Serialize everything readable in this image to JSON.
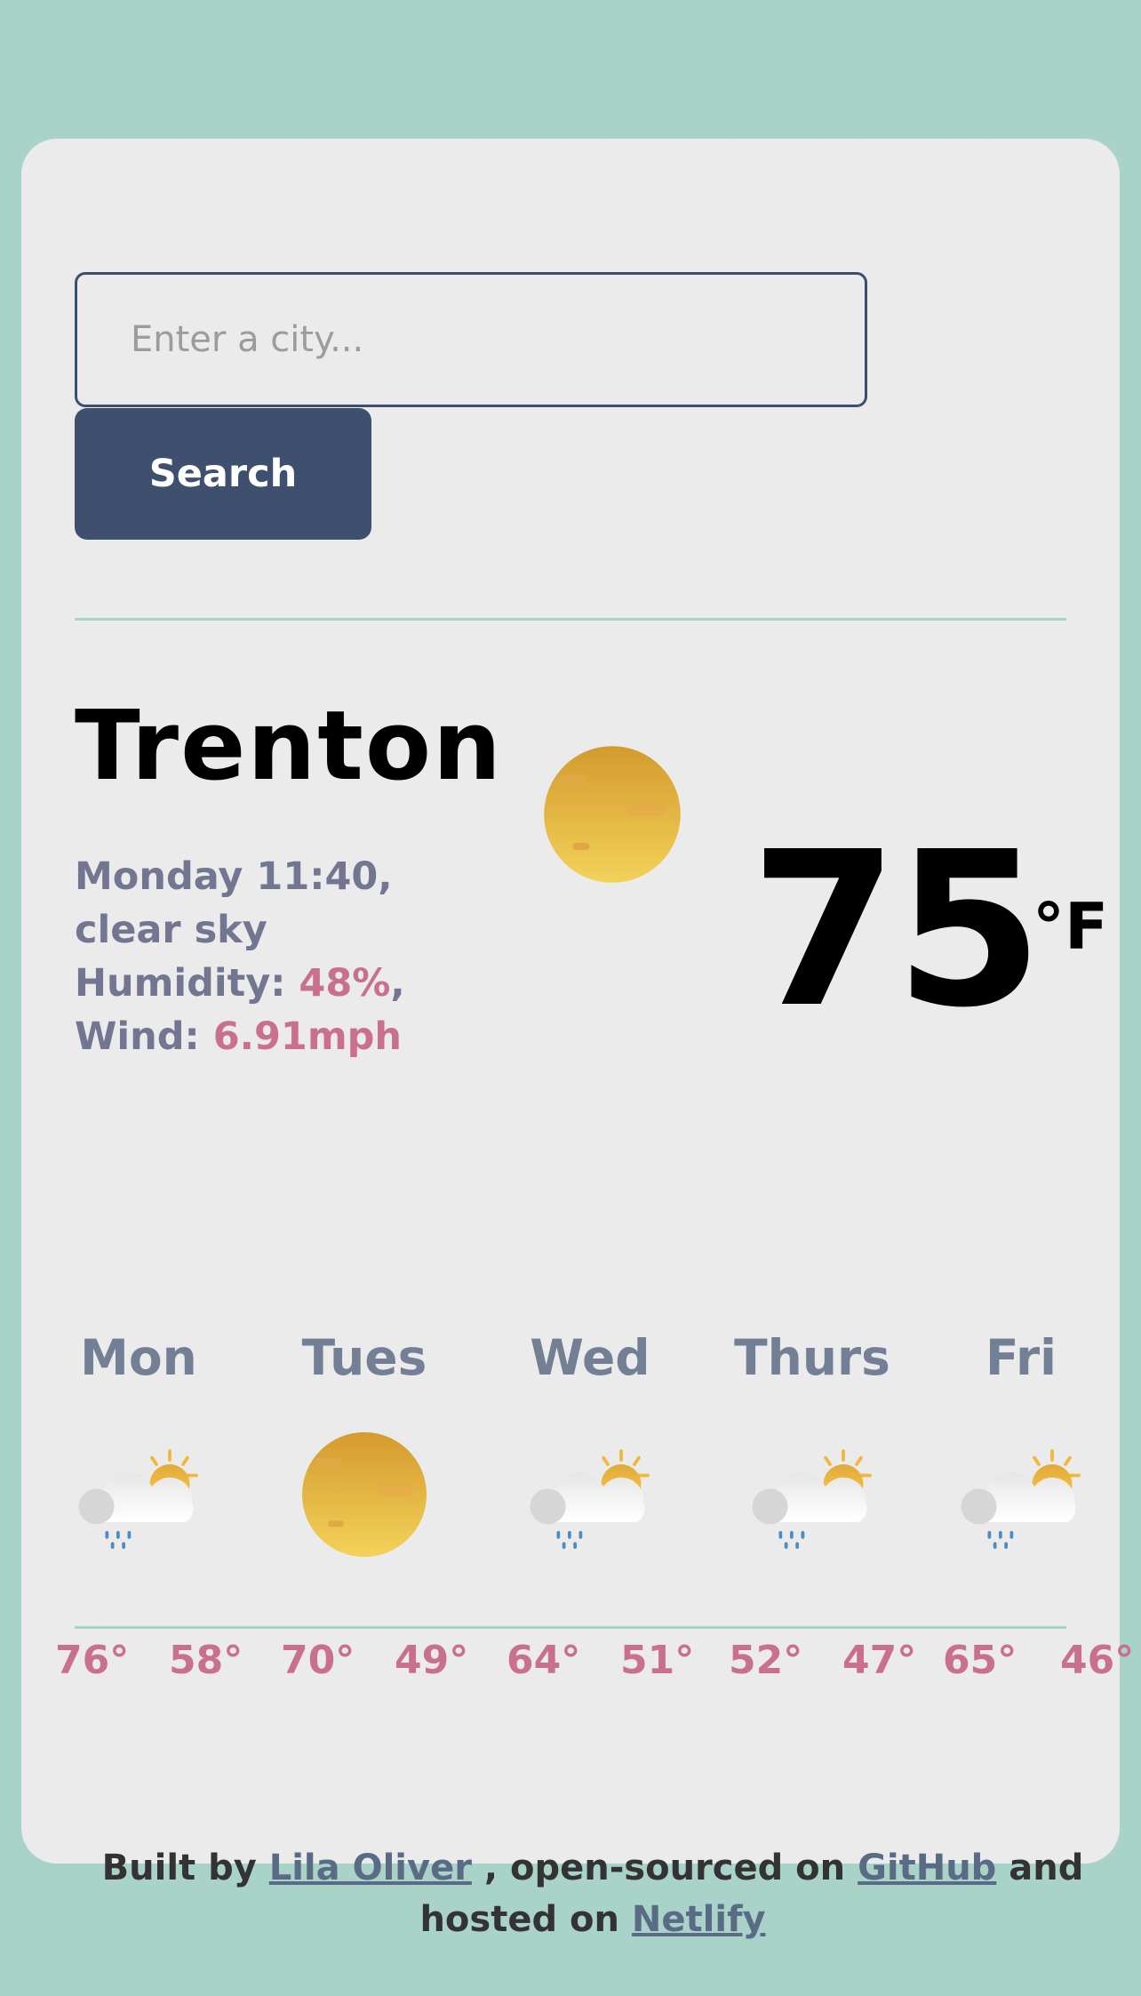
{
  "search": {
    "placeholder": "Enter a city...",
    "button_label": "Search"
  },
  "current": {
    "city": "Trenton",
    "datetime_conditions": "Monday 11:40, clear sky",
    "humidity_label": "Humidity: ",
    "humidity_value": "48%",
    "wind_label": "Wind: ",
    "wind_value": "6.91mph",
    "temperature": "75",
    "unit": "°F",
    "icon": "clear-sky-icon"
  },
  "forecast": [
    {
      "day": "Mon",
      "icon": "rain-partly-sunny-icon",
      "high": "76°",
      "low": "58°"
    },
    {
      "day": "Tues",
      "icon": "clear-sky-icon",
      "high": "70°",
      "low": "49°"
    },
    {
      "day": "Wed",
      "icon": "rain-partly-sunny-icon",
      "high": "64°",
      "low": "51°"
    },
    {
      "day": "Thurs",
      "icon": "rain-partly-sunny-icon",
      "high": "52°",
      "low": "47°"
    },
    {
      "day": "Fri",
      "icon": "rain-partly-sunny-icon",
      "high": "65°",
      "low": "46°"
    }
  ],
  "footer": {
    "built_by": "Built by ",
    "author": "Lila Oliver",
    "open_sourced": " , open-sourced on ",
    "github": "GitHub",
    "and": " and",
    "hosted_on": "hosted on ",
    "netlify": "Netlify"
  },
  "colors": {
    "background": "#a9d2c9",
    "card": "#ebebeb",
    "accent": "#3e506e",
    "highlight": "#c8708e",
    "muted_text": "#737690"
  }
}
